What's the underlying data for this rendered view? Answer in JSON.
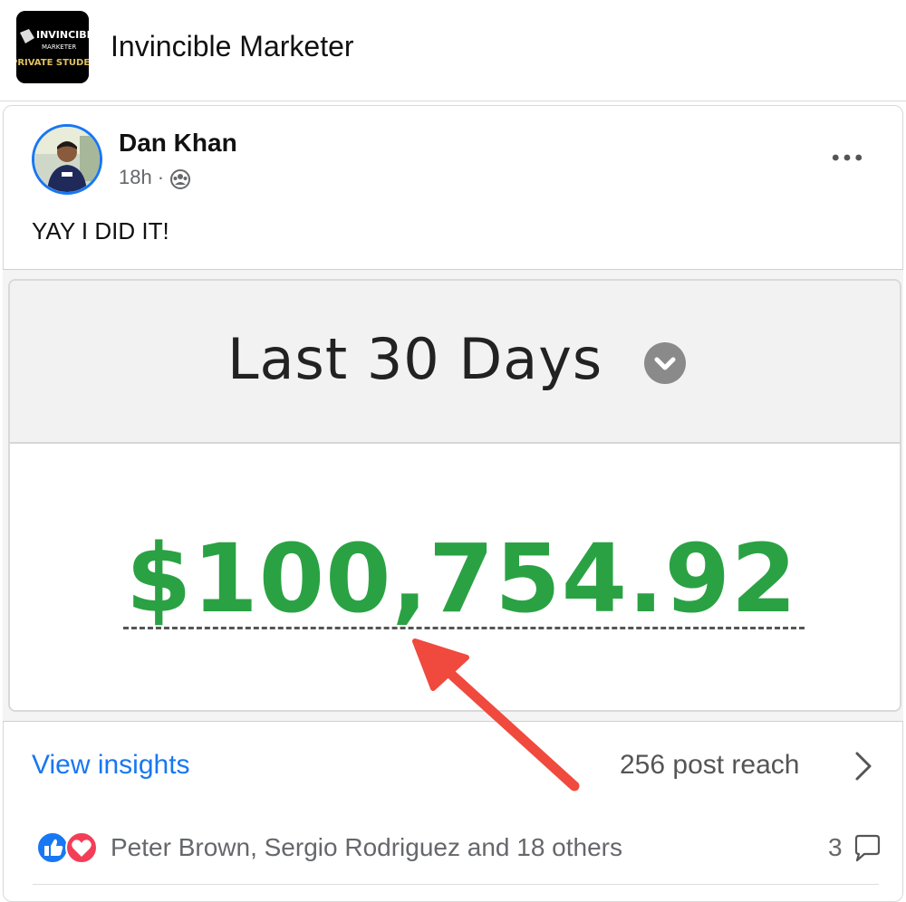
{
  "group": {
    "name": "Invincible Marketer",
    "logo_text": [
      "INVINCIBLE",
      "MARKETER",
      "PRIVATE STUDENT GROUP"
    ]
  },
  "post": {
    "author": "Dan Khan",
    "time": "18h",
    "separator": "·",
    "audience_icon": "group-icon",
    "text": "YAY I DID IT!",
    "more_icon": "more-horizontal-icon"
  },
  "image": {
    "period_label": "Last 30 Days",
    "dropdown_icon": "chevron-down-icon",
    "amount": "$100,754.92",
    "amount_color": "#2aa244",
    "annotation": "red-arrow-icon"
  },
  "insights": {
    "view_label": "View insights",
    "reach": "256 post reach",
    "chevron_icon": "chevron-right-icon"
  },
  "reactions": {
    "icons": [
      "like-icon",
      "love-icon"
    ],
    "names": "Peter Brown, Sergio Rodriguez and 18 others",
    "comment_count": "3",
    "comment_icon": "comment-icon"
  },
  "colors": {
    "link_blue": "#1877f2",
    "love_red": "#f33e58",
    "arrow_red": "#ef4a3d"
  }
}
